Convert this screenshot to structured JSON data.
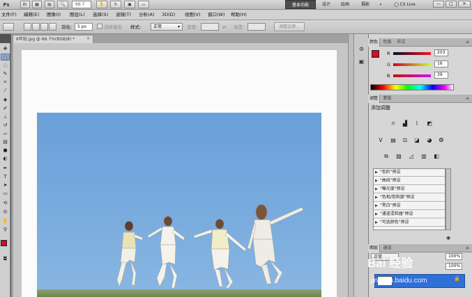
{
  "titlebar": {
    "logo": "Ps",
    "zoom": "66.7",
    "workspaces": [
      "基本功能",
      "设计",
      "绘画",
      "摄影"
    ],
    "more": "»",
    "cslive": "CS Live",
    "window_buttons": [
      "—",
      "□",
      "✕"
    ]
  },
  "menu": [
    "文件(F)",
    "编辑(E)",
    "图像(I)",
    "图层(L)",
    "选择(S)",
    "滤镜(T)",
    "分析(A)",
    "3D(D)",
    "视图(V)",
    "窗口(W)",
    "帮助(H)"
  ],
  "options": {
    "feather_label": "羽化:",
    "feather_value": "5 px",
    "antialias_label": "消除锯齿",
    "style_label": "样式:",
    "style_value": "正常",
    "width_label": "宽度:",
    "height_label": "高度:",
    "refine_button": "调整边缘..."
  },
  "document": {
    "tab_title": "6年轻.jpg @ 66.7%(RGB/8) *",
    "close": "×"
  },
  "color_panel": {
    "tabs": [
      "颜色",
      "色板",
      "样式"
    ],
    "r_label": "R",
    "r_value": "203",
    "g_label": "G",
    "g_value": "16",
    "b_label": "B",
    "b_value": "39",
    "fg_color": "#cb1027"
  },
  "adjust_panel": {
    "tabs": [
      "调整",
      "蒙版"
    ],
    "title": "添加调整",
    "presets": [
      "\"色阶\"预设",
      "\"曲线\"预设",
      "\"曝光度\"预设",
      "\"色相/饱和度\"预设",
      "\"黑白\"预设",
      "\"通道混和器\"预设",
      "\"可选颜色\"预设"
    ]
  },
  "layers_panel": {
    "tabs": [
      "图层",
      "通道"
    ],
    "blend_mode": "正常",
    "opacity": "100%",
    "fill": "100%"
  },
  "watermark": {
    "logo": "Bai 经验",
    "url": "jingyan.baidu.com"
  },
  "colors": {
    "accent": "#2f6fd6",
    "sky": "#6aa0d9"
  }
}
